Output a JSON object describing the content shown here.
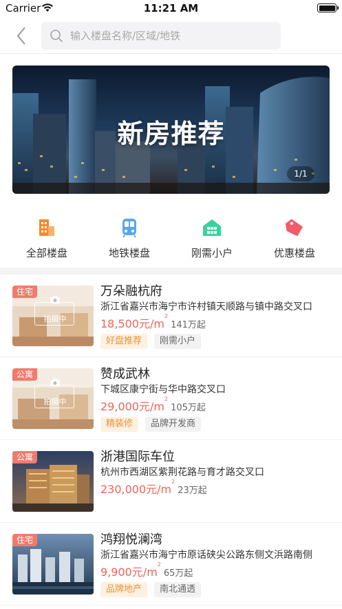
{
  "status_bar": {
    "carrier": "Carrier",
    "time": "11:21 AM"
  },
  "search": {
    "placeholder": "输入楼盘名称/区域/地铁"
  },
  "banner": {
    "title": "新房推荐",
    "pager": "1/1"
  },
  "categories": [
    {
      "label": "全部楼盘",
      "icon": "building-icon",
      "color": "#f6892a"
    },
    {
      "label": "地铁楼盘",
      "icon": "subway-icon",
      "color": "#5aa7f0"
    },
    {
      "label": "刚需小户",
      "icon": "house-icon",
      "color": "#3ecf9b"
    },
    {
      "label": "优惠楼盘",
      "icon": "discount-tag-icon",
      "color": "#f25b6a"
    }
  ],
  "listings": [
    {
      "type_tag": "住宅",
      "name": "万朵融杭府",
      "address": "浙江省嘉兴市海宁市许村镇天顺路与镇中路交叉口",
      "price": "18,500元/m",
      "total": "141万起",
      "features": [
        "好盘推荐",
        "刚需小户"
      ],
      "shooting": "拍摄中"
    },
    {
      "type_tag": "公寓",
      "name": "赞成武林",
      "address": "下城区康宁街与华中路交叉口",
      "price": "29,000元/m",
      "total": "105万起",
      "features": [
        "精装修",
        "品牌开发商"
      ],
      "shooting": "拍摄中"
    },
    {
      "type_tag": "公寓",
      "name": "浙港国际车位",
      "address": "杭州市西湖区紫荆花路与育才路交叉口",
      "price": "230,000元/m",
      "total": "23万起",
      "features": []
    },
    {
      "type_tag": "住宅",
      "name": "鸿翔悦澜湾",
      "address": "浙江省嘉兴市海宁市原话硖尖公路东侧文浜路南侧",
      "price": "9,900元/m",
      "total": "65万起",
      "features": [
        "品牌地产",
        "南北通透"
      ]
    }
  ],
  "sup_mark": "2",
  "colors": {
    "accent": "#f0635a",
    "tag_bg": "#f07b6d",
    "feature_orange": "#e8943a"
  }
}
